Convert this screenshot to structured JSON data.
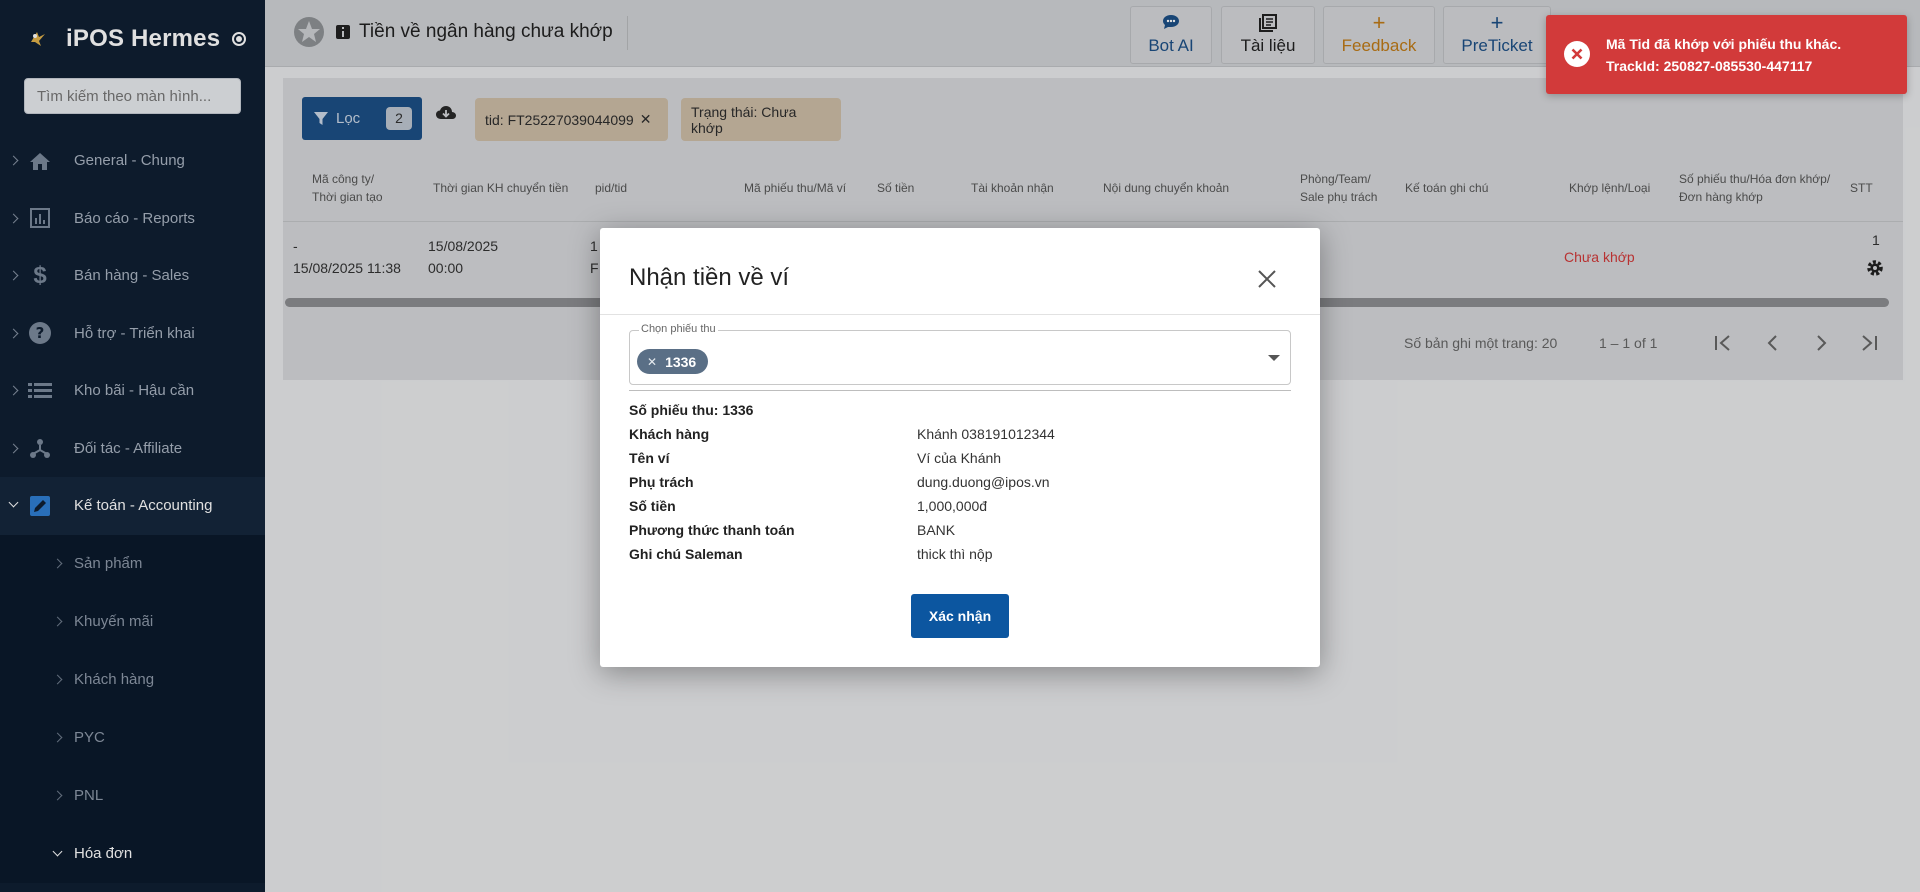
{
  "app": {
    "brand": "iPOS Hermes",
    "search_placeholder": "Tìm kiếm theo màn hình..."
  },
  "sidebar": {
    "items": [
      {
        "label": "General - Chung",
        "icon": "home-icon"
      },
      {
        "label": "Báo cáo - Reports",
        "icon": "chart-icon"
      },
      {
        "label": "Bán hàng - Sales",
        "icon": "dollar-icon"
      },
      {
        "label": "Hỗ trợ - Triển khai",
        "icon": "help-icon"
      },
      {
        "label": "Kho bãi - Hậu cần",
        "icon": "list-icon"
      },
      {
        "label": "Đối tác - Affiliate",
        "icon": "network-icon"
      },
      {
        "label": "Kế toán - Accounting",
        "icon": "edit-icon",
        "active": true
      }
    ],
    "sub_items": [
      {
        "label": "Sản phẩm"
      },
      {
        "label": "Khuyến mãi"
      },
      {
        "label": "Khách hàng"
      },
      {
        "label": "PYC"
      },
      {
        "label": "PNL"
      },
      {
        "label": "Hóa đơn",
        "open": true
      }
    ]
  },
  "header": {
    "page_title": "Tiền về ngân hàng chưa khớp",
    "buttons": [
      {
        "label": "Bot AI",
        "icon": "chat-icon",
        "color": "#1c4f86"
      },
      {
        "label": "Tài liệu",
        "icon": "library-icon",
        "color": "#222222"
      },
      {
        "label": "Feedback",
        "icon": "plus-icon",
        "color": "#c07a16"
      },
      {
        "label": "PreTicket",
        "icon": "plus-icon",
        "color": "#1c4f86"
      }
    ]
  },
  "filters": {
    "filter_label": "Lọc",
    "filter_count": "2",
    "chips": [
      {
        "label": "tid: FT25227039044099"
      },
      {
        "label": "Trạng thái: Chưa khớp"
      }
    ]
  },
  "table": {
    "headers": [
      "Mã công ty/\nThời gian tạo",
      "Thời gian KH chuyển tiền",
      "pid/tid",
      "Mã phiếu thu/Mã ví",
      "Số tiền",
      "Tài khoản nhận",
      "Nội dung chuyển khoản",
      "Phòng/Team/\nSale phụ trách",
      "Kế toán ghi chú",
      "Khớp lệnh/Loại",
      "Số phiếu thu/Hóa đơn khớp/\nĐơn hàng khớp",
      "STT"
    ],
    "row": {
      "company": "-",
      "created": "15/08/2025 11:38",
      "transfer_date": "15/08/2025",
      "transfer_time": "00:00",
      "pid": "1",
      "tid": "F",
      "status": "Chưa khớp",
      "stt": "1"
    },
    "pager": {
      "rows_per_page": "Số bản ghi một trang: 20",
      "range": "1 – 1 of 1"
    }
  },
  "modal": {
    "title": "Nhận tiền về ví",
    "field_label": "Chọn phiếu thu",
    "selected_tag": "1336",
    "receipt_heading": "Số phiếu thu: 1336",
    "rows": [
      {
        "k": "Khách hàng",
        "v": "Khánh 038191012344"
      },
      {
        "k": "Tên ví",
        "v": "Ví của Khánh"
      },
      {
        "k": "Phụ trách",
        "v": "dung.duong@ipos.vn"
      },
      {
        "k": "Số tiền",
        "v": "1,000,000đ"
      },
      {
        "k": "Phương thức thanh toán",
        "v": "BANK"
      },
      {
        "k": "Ghi chú Saleman",
        "v": "thick thì nộp"
      }
    ],
    "confirm_label": "Xác nhận"
  },
  "toast": {
    "message": "Mã Tid đã khớp với phiếu thu khác. TrackId: 250827-085530-447117",
    "color": "#d23a3a"
  }
}
